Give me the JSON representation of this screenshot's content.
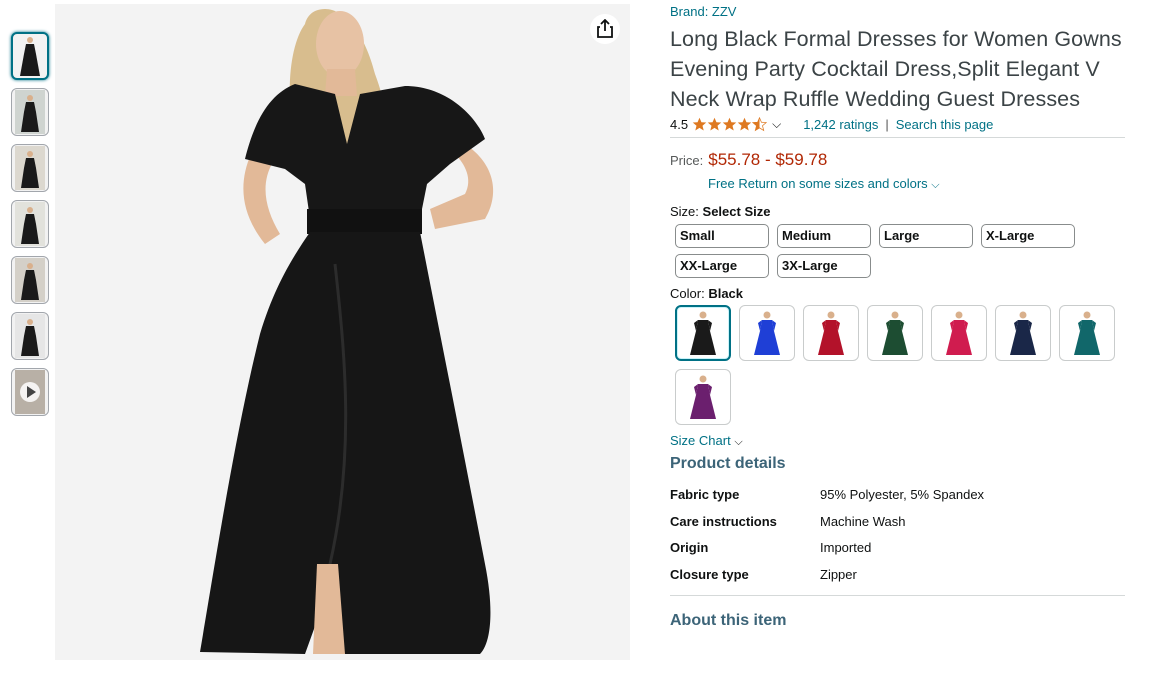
{
  "product": {
    "brand": "Brand: ZZV",
    "title": "Long Black Formal Dresses for Women Gowns Evening Party Cocktail Dress,Split Elegant V Neck Wrap Ruffle Wedding Guest Dresses",
    "rating": "4.5",
    "rating_value": 4.5,
    "ratings_count": "1,242 ratings",
    "search_link": "Search this page",
    "separator": "|",
    "price_label": "Price:",
    "price": "$55.78 - $59.78",
    "free_return": "Free Return on some sizes and colors",
    "size_label": "Size:",
    "size_value": "Select Size",
    "sizes": [
      "Small",
      "Medium",
      "Large",
      "X-Large",
      "XX-Large",
      "3X-Large"
    ],
    "color_label": "Color:",
    "color_value": "Black",
    "colors": [
      {
        "hex": "#1a1a1a"
      },
      {
        "hex": "#1f3fd6"
      },
      {
        "hex": "#b3122a"
      },
      {
        "hex": "#1d4d32"
      },
      {
        "hex": "#d01c4f"
      },
      {
        "hex": "#1a2748"
      },
      {
        "hex": "#11676a"
      },
      {
        "hex": "#6b1f6e"
      }
    ],
    "size_chart": "Size Chart",
    "product_details_heading": "Product details",
    "details": [
      {
        "key": "Fabric type",
        "value": "95% Polyester, 5% Spandex"
      },
      {
        "key": "Care instructions",
        "value": "Machine Wash"
      },
      {
        "key": "Origin",
        "value": "Imported"
      },
      {
        "key": "Closure type",
        "value": "Zipper"
      }
    ],
    "about_heading": "About this item"
  },
  "gallery": {
    "thumbnail_count": 7,
    "selected_index": 0,
    "has_video_thumbnail": true
  },
  "colors": {
    "link": "#007185",
    "price": "#b12704",
    "heading": "#3c6478"
  }
}
